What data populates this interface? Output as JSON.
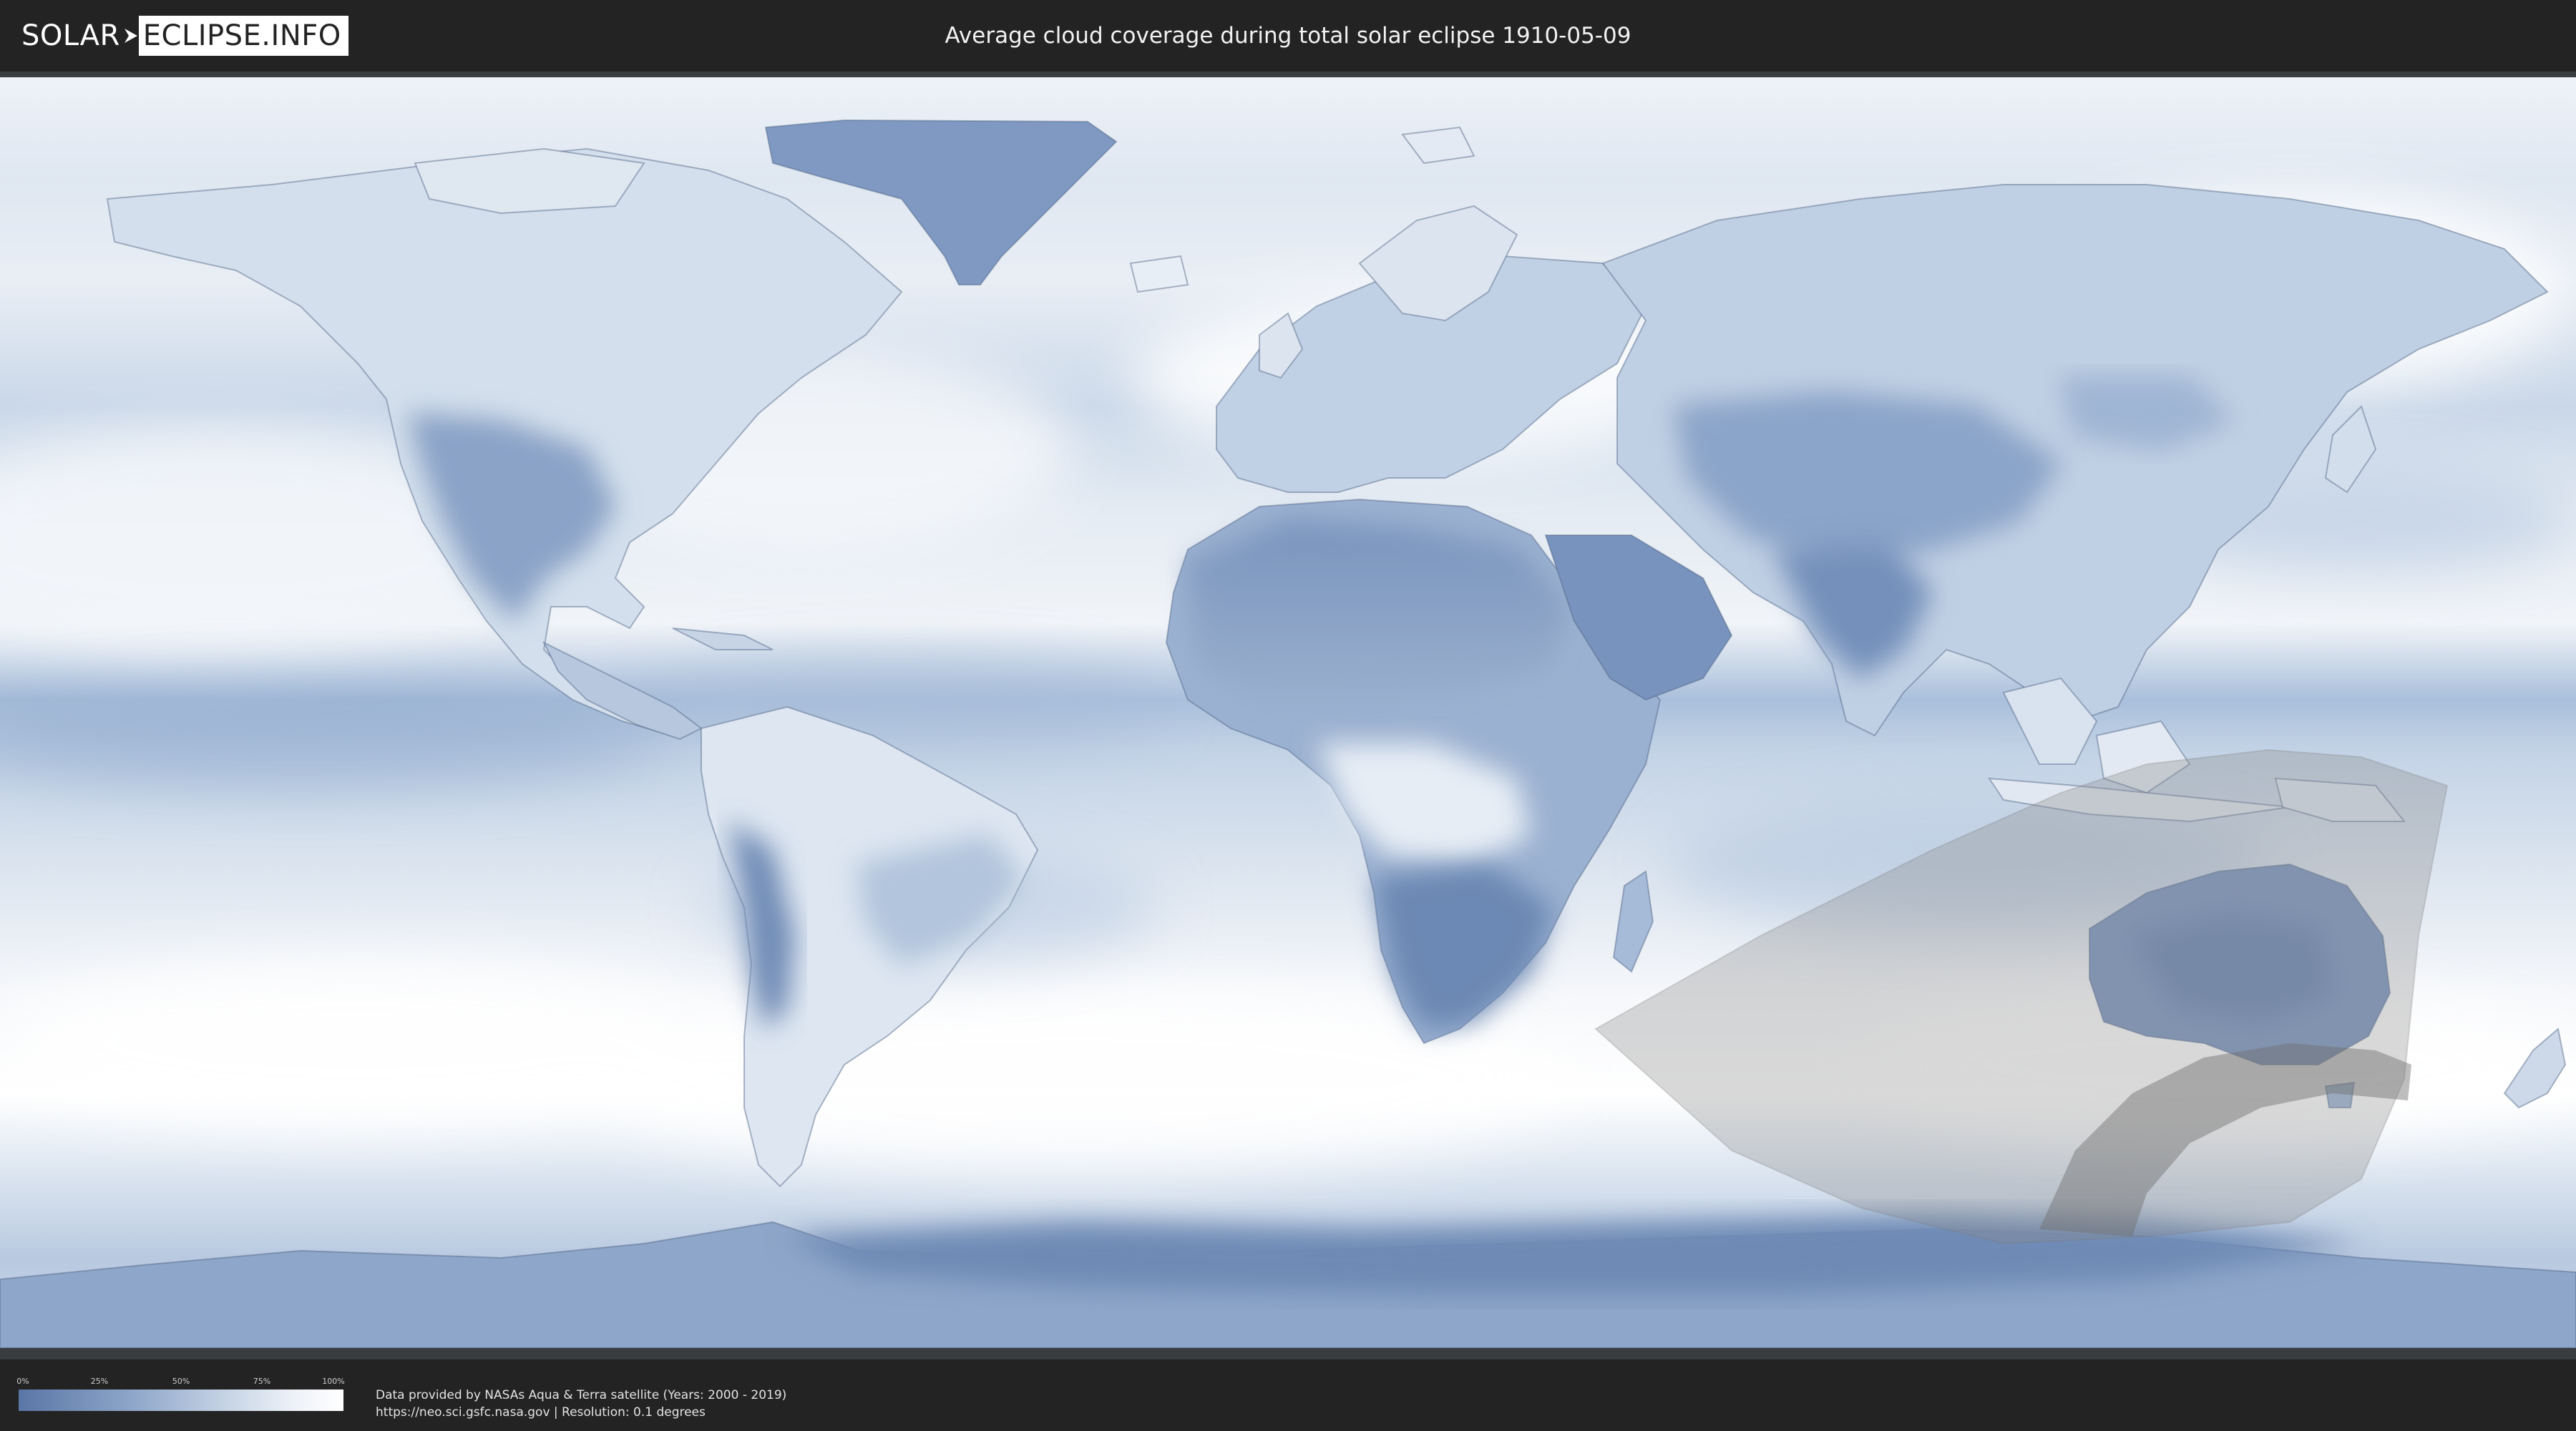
{
  "header": {
    "logo_solar": "SOLAR",
    "logo_eclipse": "ECLIPSE.INFO",
    "title": "Average cloud coverage during total solar eclipse 1910-05-09"
  },
  "map": {
    "colors": {
      "ocean_clear": "#b9cbe2",
      "cloud_white": "#f4f7fb",
      "land_clear": "#6f8bb6",
      "border": "#4a5f80",
      "eclipse_overlay": "#8a8a8a"
    }
  },
  "legend": {
    "ticks": [
      "0%",
      "25%",
      "50%",
      "75%",
      "100%"
    ]
  },
  "credits": {
    "line1": "Data provided by NASAs Aqua & Terra satellite (Years: 2000 - 2019)",
    "line2": "https://neo.sci.gsfc.nasa.gov | Resolution: 0.1 degrees"
  }
}
